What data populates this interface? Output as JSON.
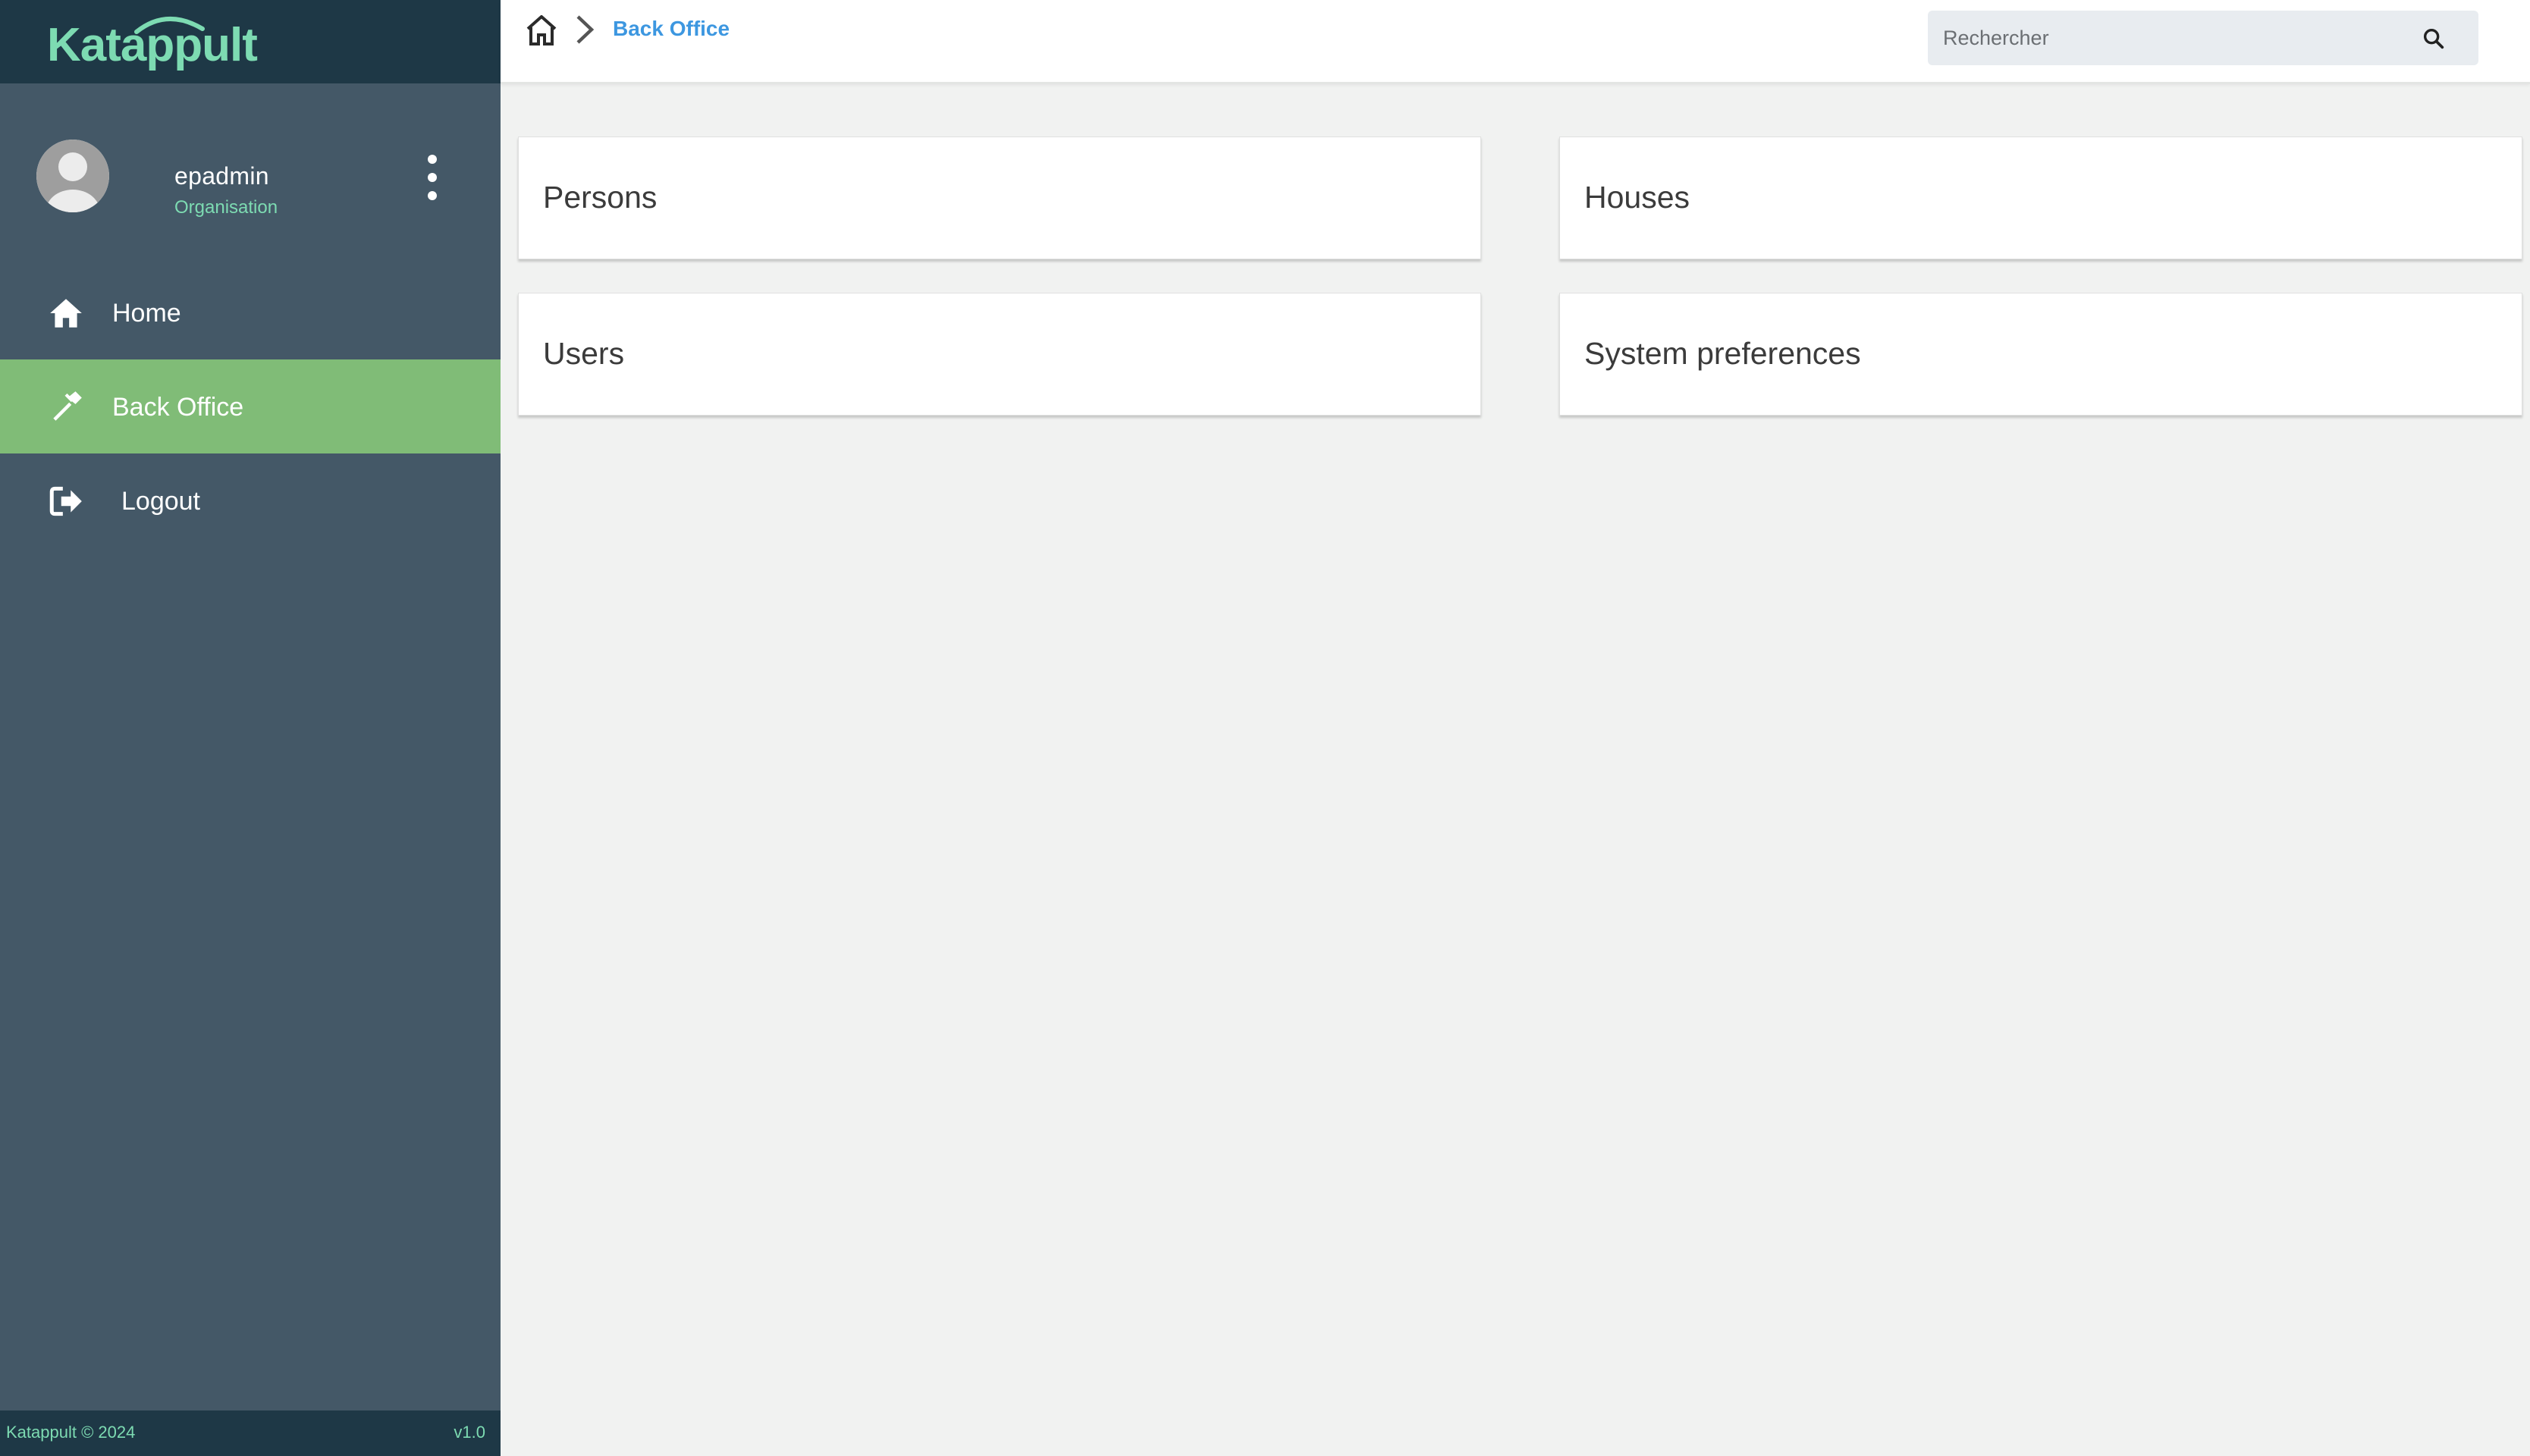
{
  "app": {
    "logo_text": "Katappult"
  },
  "user": {
    "name": "epadmin",
    "organisation": "Organisation"
  },
  "sidebar": {
    "items": [
      {
        "label": "Home",
        "icon": "home-icon",
        "active": false
      },
      {
        "label": "Back Office",
        "icon": "hammer-icon",
        "active": true
      },
      {
        "label": "Logout",
        "icon": "logout-icon",
        "active": false
      }
    ],
    "footer": {
      "copyright": "Katappult © 2024",
      "version": "v1.0"
    }
  },
  "header": {
    "breadcrumb": {
      "current": "Back Office"
    },
    "search": {
      "placeholder": "Rechercher",
      "value": ""
    }
  },
  "main": {
    "cards": [
      {
        "title": "Persons"
      },
      {
        "title": "Houses"
      },
      {
        "title": "Users"
      },
      {
        "title": "System preferences"
      }
    ]
  },
  "colors": {
    "sidebar_bg": "#445867",
    "logo_bar_bg": "#1e3846",
    "active_item": "#80bc77",
    "accent_teal": "#7ddbb2",
    "link_blue": "#3d97e0",
    "content_bg": "#f1f2f1"
  }
}
